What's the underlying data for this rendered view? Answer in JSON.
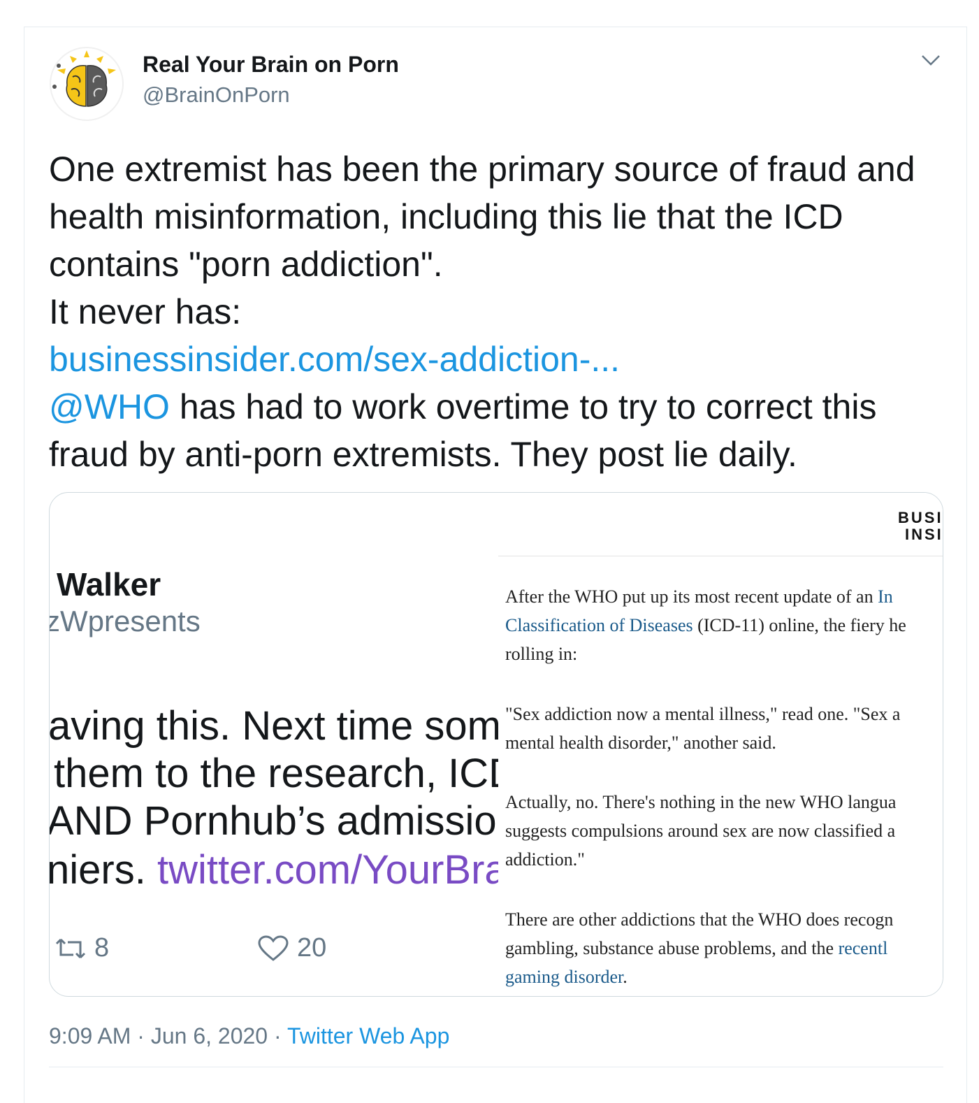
{
  "author": {
    "display_name": "Real Your Brain on Porn",
    "handle": "@BrainOnPorn"
  },
  "tweet": {
    "lines": [
      "One extremist has been the primary source of fraud and",
      "health misinformation, including this lie that the ICD",
      "contains \"porn addiction\".",
      "It never has:"
    ],
    "link": "businessinsider.com/sex-addiction-...",
    "mention": "@WHO",
    "mention_rest": " has had to work overtime to try to correct this",
    "last_line": "fraud by anti-porn extremists. They post lie daily."
  },
  "media": {
    "left": {
      "name": "Walker",
      "handle": "zWpresents",
      "line1": "aving this. Next time som",
      "line2": "them to the research, ICD",
      "line3": "AND Pornhub’s admission",
      "line4_prefix": "niers. ",
      "line4_link": "twitter.com/YourBra",
      "retweets": "8",
      "likes": "20"
    },
    "right": {
      "logo_line1": "BUSI",
      "logo_line2": "INSI",
      "p1_a": "After the WHO put up its most recent update of an ",
      "p1_link1": "In",
      "p1_link2": "Classification of Diseases",
      "p1_b": " (ICD-11) online, the fiery he",
      "p1_c": "rolling in:",
      "p2_a": "\"Sex addiction now a mental illness,\" read one. \"Sex a",
      "p2_b": "mental health disorder,\" another said.",
      "p3_a": "Actually, no. There's nothing in the new WHO langua",
      "p3_b": "suggests compulsions around sex are now classified a",
      "p3_c": "addiction.\"",
      "p4_a": "There are other addictions that the WHO does recogn",
      "p4_b": "gambling, substance abuse problems, and the ",
      "p4_link1": "recentl",
      "p4_link2": "gaming disorder",
      "p4_c": "."
    }
  },
  "meta": {
    "time": "9:09 AM",
    "sep": " · ",
    "date": "Jun 6, 2020",
    "source": "Twitter Web App"
  },
  "colors": {
    "link": "#1b95e0",
    "secondary_text": "#657786",
    "brain_yellow": "#f5c518",
    "brain_gray": "#5a5a5a"
  },
  "icons": [
    "brain-logo-icon",
    "chevron-down-icon",
    "retweet-icon",
    "heart-icon"
  ]
}
